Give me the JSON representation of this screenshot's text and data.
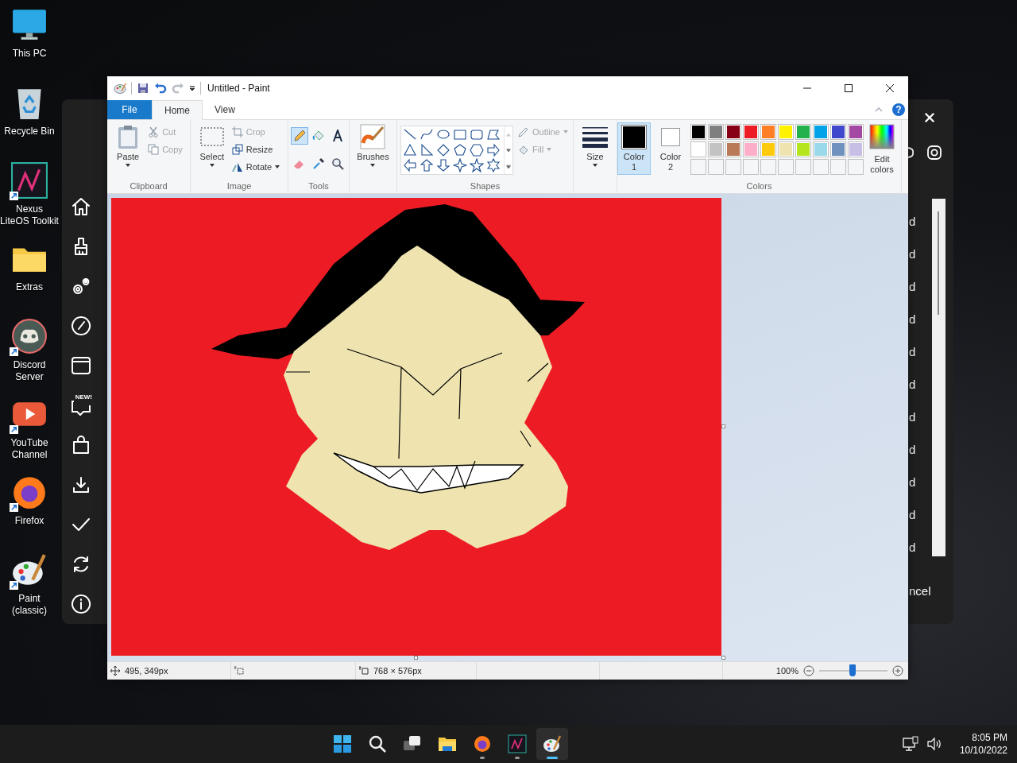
{
  "desktop_icons": [
    {
      "kind": "pc",
      "label": "This PC",
      "shortcut": false
    },
    {
      "kind": "recycle",
      "label": "Recycle Bin",
      "shortcut": false
    },
    {
      "kind": "nexus",
      "label": "Nexus LiteOS Toolkit",
      "shortcut": true
    },
    {
      "kind": "folder",
      "label": "Extras",
      "shortcut": false
    },
    {
      "kind": "discord",
      "label": "Discord Server",
      "shortcut": true
    },
    {
      "kind": "youtube",
      "label": "YouTube Channel",
      "shortcut": true
    },
    {
      "kind": "firefox",
      "label": "Firefox",
      "shortcut": true
    },
    {
      "kind": "paint",
      "label": "Paint (classic)",
      "shortcut": true
    }
  ],
  "side_panel": {
    "new_badge": "NEW!",
    "cut_off_labels": [
      "d",
      "d",
      "d",
      "d",
      "d",
      "d",
      "d",
      "d",
      "d",
      "d",
      "d"
    ],
    "cut_off_button": "ncel"
  },
  "paint": {
    "title": "Untitled - Paint",
    "help": "?",
    "tabs": [
      {
        "label": "File",
        "kind": "file",
        "selected": false
      },
      {
        "label": "Home",
        "kind": "tab",
        "selected": true
      },
      {
        "label": "View",
        "kind": "tab",
        "selected": false
      }
    ],
    "clipboard": {
      "paste": "Paste",
      "cut": {
        "label": "Cut",
        "disabled": true
      },
      "copy": {
        "label": "Copy",
        "disabled": true
      },
      "group": "Clipboard"
    },
    "image": {
      "select": "Select",
      "crop": {
        "label": "Crop",
        "disabled": true
      },
      "resize": {
        "label": "Resize",
        "disabled": false
      },
      "rotate": {
        "label": "Rotate",
        "disabled": false
      },
      "group": "Image"
    },
    "tools": {
      "group": "Tools",
      "items": [
        {
          "kind": "pencil",
          "selected": true
        },
        {
          "kind": "fill",
          "selected": false
        },
        {
          "kind": "text",
          "selected": false
        },
        {
          "kind": "eraser",
          "selected": false
        },
        {
          "kind": "picker",
          "selected": false
        },
        {
          "kind": "magnifier",
          "selected": false
        }
      ]
    },
    "brushes": "Brushes",
    "shapes": {
      "group": "Shapes",
      "outline": {
        "label": "Outline",
        "disabled": true
      },
      "fill": {
        "label": "Fill",
        "disabled": true
      }
    },
    "size": "Size",
    "colors": {
      "group": "Colors",
      "color1": {
        "label": "Color",
        "index": "1",
        "color": "#000000",
        "selected": true
      },
      "color2": {
        "label": "Color",
        "index": "2",
        "color": "#ffffff",
        "selected": false
      },
      "palette": [
        {
          "color": "#000000"
        },
        {
          "color": "#7f7f7f"
        },
        {
          "color": "#880015"
        },
        {
          "color": "#ed1c24"
        },
        {
          "color": "#ff7f27"
        },
        {
          "color": "#fff200"
        },
        {
          "color": "#22b14c"
        },
        {
          "color": "#00a2e8"
        },
        {
          "color": "#3f48cc"
        },
        {
          "color": "#a349a4"
        },
        {
          "color": "#ffffff"
        },
        {
          "color": "#c3c3c3"
        },
        {
          "color": "#b97a57"
        },
        {
          "color": "#ffaec9"
        },
        {
          "color": "#ffc90e"
        },
        {
          "color": "#efe4b0"
        },
        {
          "color": "#b5e61d"
        },
        {
          "color": "#99d9ea"
        },
        {
          "color": "#7092be"
        },
        {
          "color": "#c8bfe7"
        }
      ],
      "edit": "Edit colors"
    },
    "status": {
      "position": "495, 349px",
      "size": "768 × 576px",
      "zoom": "100%",
      "zoom_slider": {
        "level": 0.49
      }
    }
  },
  "taskbar": {
    "apps": [
      {
        "kind": "start",
        "running": false,
        "active": false
      },
      {
        "kind": "search",
        "running": false,
        "active": false
      },
      {
        "kind": "taskview",
        "running": false,
        "active": false
      },
      {
        "kind": "explorer",
        "running": false,
        "active": false
      },
      {
        "kind": "firefox",
        "running": true,
        "active": false
      },
      {
        "kind": "nexus",
        "running": true,
        "active": false
      },
      {
        "kind": "paint",
        "running": true,
        "active": true
      }
    ],
    "time": "8:05 PM",
    "date": "10/10/2022"
  }
}
